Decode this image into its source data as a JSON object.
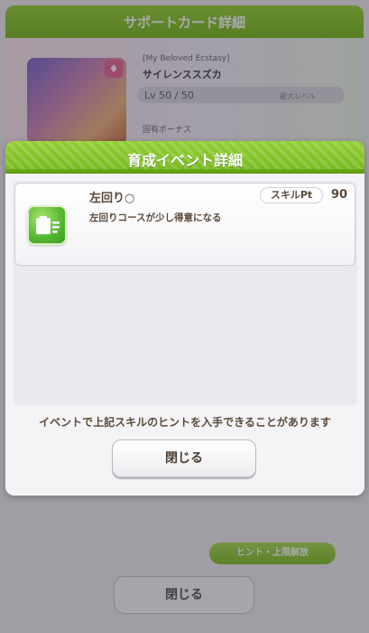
{
  "background": {
    "header_title": "サポートカード詳細",
    "card_subtitle": "[My Beloved Ecstasy]",
    "card_name": "サイレンススズカ",
    "level_text": "Lv 50 / 50",
    "level_right": "最大レベル",
    "effect_label": "固有ボーナス",
    "green_button": "ヒント・上限解放",
    "close_label": "閉じる"
  },
  "dialog": {
    "title": "育成イベント詳細",
    "skill": {
      "name": "左回り○",
      "description": "左回りコースが少し得意になる",
      "pt_label": "スキルPt",
      "pt_value": "90",
      "icon": "left-turn-skill-icon"
    },
    "note": "イベントで上記スキルのヒントを入手できることがあります",
    "close_label": "閉じる"
  },
  "colors": {
    "header_green": "#7cbc22",
    "text_brown": "#5a4a3a",
    "icon_green": "#55b632"
  }
}
